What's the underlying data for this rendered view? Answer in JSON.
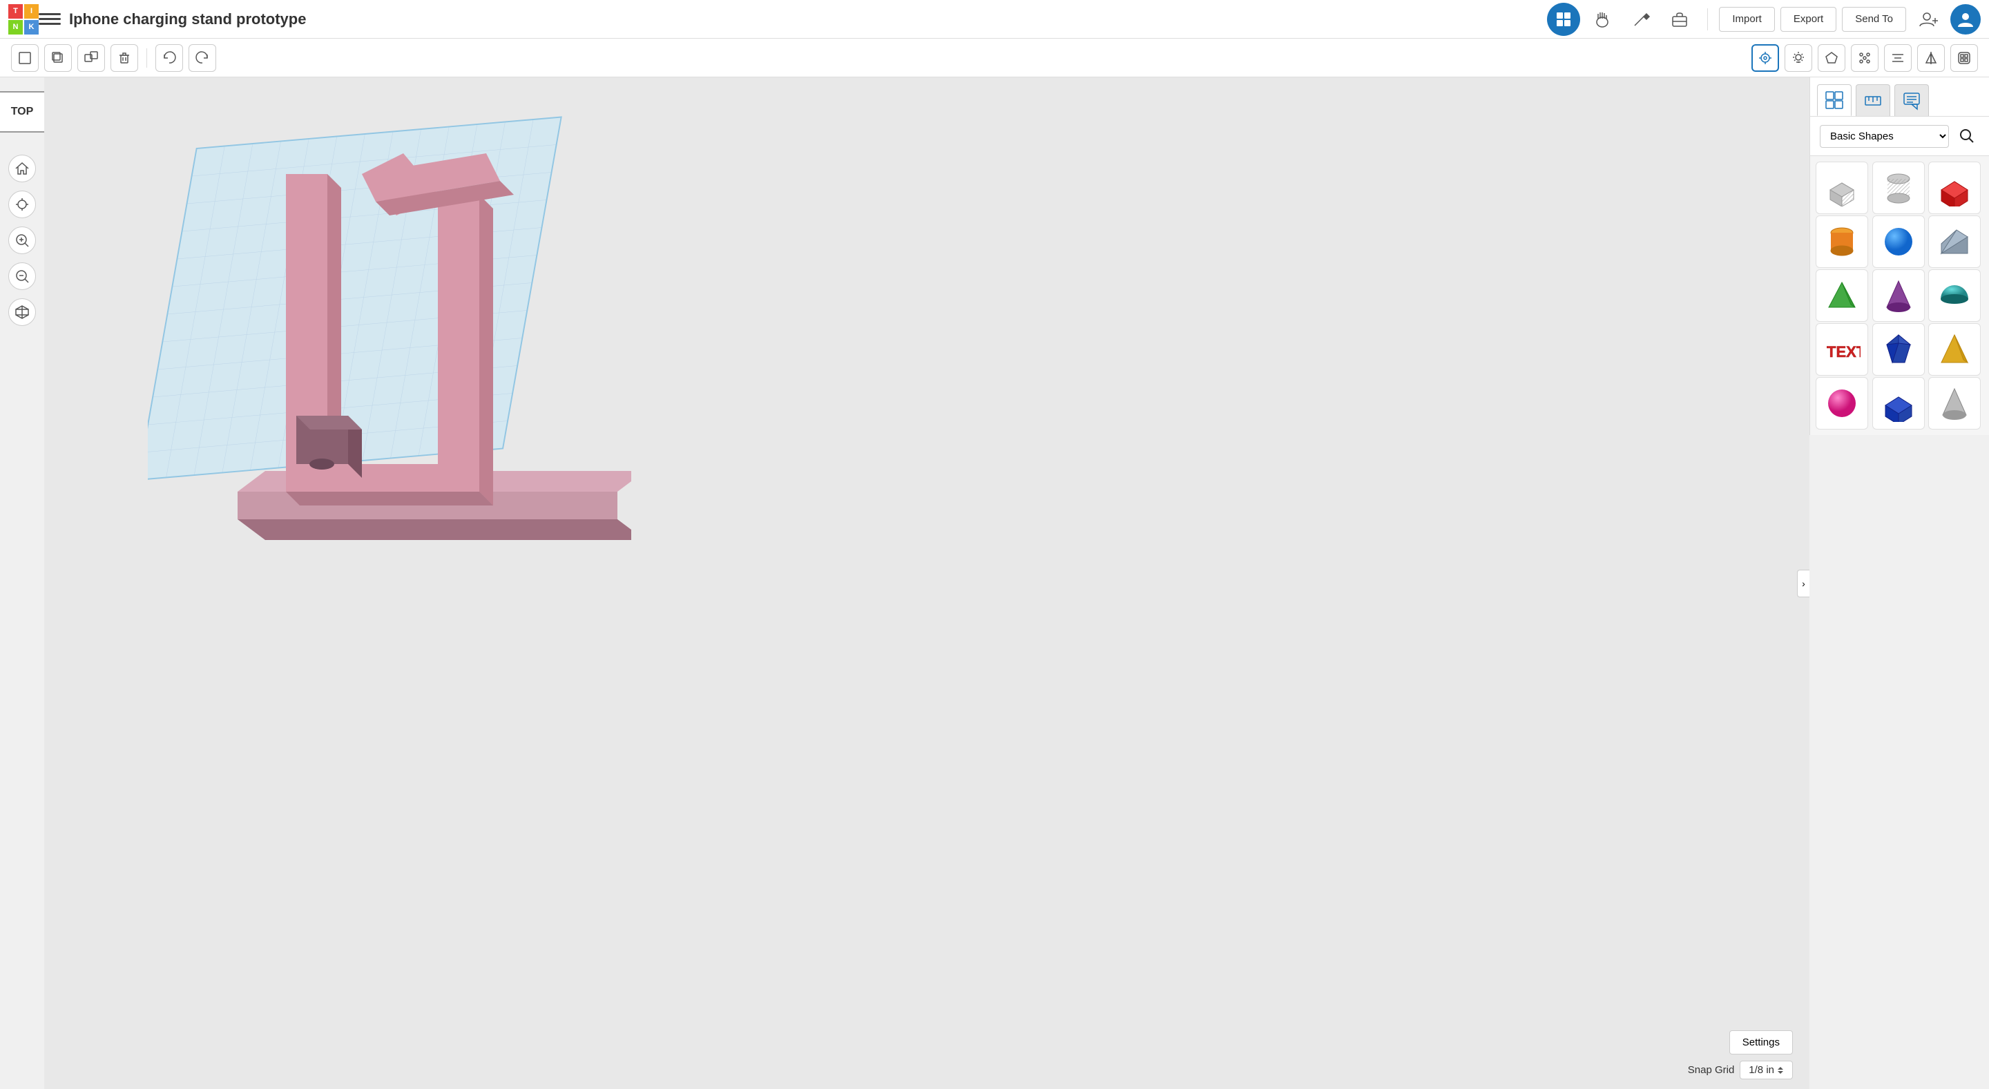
{
  "navbar": {
    "logo_letters": [
      "T",
      "I",
      "N",
      "K"
    ],
    "project_title": "Iphone charging stand prototype",
    "nav_icons": [
      "grid",
      "handprint",
      "pick",
      "briefcase"
    ],
    "actions": [
      "Import",
      "Export",
      "Send To"
    ],
    "user_icon": "user-add",
    "avatar": "avatar"
  },
  "toolbar": {
    "tools": [
      {
        "name": "new",
        "icon": "□",
        "label": "New"
      },
      {
        "name": "copy",
        "icon": "⧉",
        "label": "Copy"
      },
      {
        "name": "duplicate",
        "icon": "⊞",
        "label": "Duplicate"
      },
      {
        "name": "delete",
        "icon": "🗑",
        "label": "Delete"
      },
      {
        "name": "undo",
        "icon": "↩",
        "label": "Undo"
      },
      {
        "name": "redo",
        "icon": "↪",
        "label": "Redo"
      }
    ],
    "view_tools": [
      {
        "name": "camera",
        "icon": "⊙",
        "label": "Camera"
      },
      {
        "name": "light",
        "icon": "💡",
        "label": "Light"
      },
      {
        "name": "shape",
        "icon": "○",
        "label": "Shape"
      },
      {
        "name": "orbit",
        "icon": "⊕",
        "label": "Orbit"
      },
      {
        "name": "align",
        "icon": "⊟",
        "label": "Align"
      },
      {
        "name": "mirror",
        "icon": "◧",
        "label": "Mirror"
      },
      {
        "name": "group",
        "icon": "⊞",
        "label": "Group"
      }
    ]
  },
  "left_panel": {
    "view_label": "TOP",
    "buttons": [
      {
        "name": "home",
        "icon": "⌂"
      },
      {
        "name": "crosshair",
        "icon": "⊕"
      },
      {
        "name": "zoom-in",
        "icon": "+"
      },
      {
        "name": "zoom-out",
        "icon": "−"
      },
      {
        "name": "cube",
        "icon": "⬡"
      }
    ]
  },
  "right_panel": {
    "tabs": [
      {
        "name": "grid-tab",
        "active": true
      },
      {
        "name": "ruler-tab",
        "active": false
      },
      {
        "name": "chat-tab",
        "active": false
      }
    ],
    "shapes_label": "Basic Shapes",
    "search_placeholder": "Search shapes",
    "shapes": [
      {
        "name": "box-hole",
        "color": "#aaa",
        "type": "box-hole"
      },
      {
        "name": "cylinder-hole",
        "color": "#aaa",
        "type": "cylinder-hole"
      },
      {
        "name": "box",
        "color": "#cc2222",
        "type": "box"
      },
      {
        "name": "cylinder",
        "color": "#e88020",
        "type": "cylinder"
      },
      {
        "name": "sphere",
        "color": "#2288cc",
        "type": "sphere"
      },
      {
        "name": "wedge",
        "color": "#7799aa",
        "type": "wedge"
      },
      {
        "name": "pyramid-green",
        "color": "#44aa44",
        "type": "pyramid"
      },
      {
        "name": "cone-purple",
        "color": "#884499",
        "type": "cone"
      },
      {
        "name": "half-sphere-teal",
        "color": "#44aaaa",
        "type": "half-sphere"
      },
      {
        "name": "text-red",
        "color": "#cc2222",
        "type": "text"
      },
      {
        "name": "gem-blue",
        "color": "#2244aa",
        "type": "gem"
      },
      {
        "name": "pyramid-yellow",
        "color": "#ddaa22",
        "type": "pyramid-y"
      },
      {
        "name": "sphere-pink",
        "color": "#cc2288",
        "type": "sphere-p"
      },
      {
        "name": "box-blue",
        "color": "#2244aa",
        "type": "box-b"
      },
      {
        "name": "cone-gray",
        "color": "#aaaaaa",
        "type": "cone-g"
      }
    ]
  },
  "canvas": {
    "settings_label": "Settings",
    "snap_grid_label": "Snap Grid",
    "snap_value": "1/8 in"
  }
}
